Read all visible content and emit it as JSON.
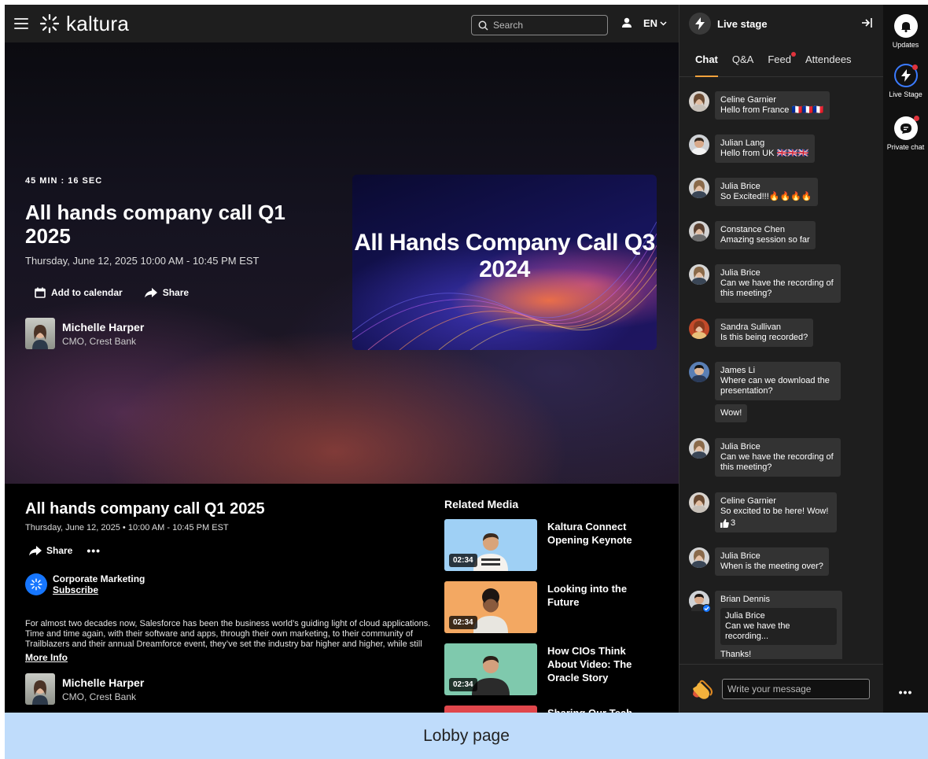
{
  "header": {
    "logo_text": "kaltura",
    "search_placeholder": "Search",
    "language": "EN"
  },
  "hero": {
    "countdown": "45 MIN : 16 SEC",
    "title": "All hands company call Q1 2025",
    "date": "Thursday, June 12, 2025  10:00 AM - 10:45 PM EST",
    "add_to_calendar": "Add to calendar",
    "share": "Share",
    "host_name": "Michelle Harper",
    "host_role": "CMO, Crest Bank",
    "banner_title": "All Hands Company Call Q3 2024"
  },
  "details": {
    "title": "All hands company call Q1 2025",
    "date": "Thursday, June 12, 2025  •  10:00 AM - 10:45 PM EST",
    "share": "Share",
    "more": "•••",
    "channel_name": "Corporate Marketing",
    "subscribe": "Subscribe",
    "description": "For almost two decades now, Salesforce has been the business world’s guiding light of cloud applications. Time and time again, with their software and apps, through their own marketing, to their community of Trailblazers and their annual Dreamforce event, they’ve set the industry bar higher and higher, while still",
    "more_info": "More Info",
    "host_name": "Michelle Harper",
    "host_role": "CMO, Crest Bank"
  },
  "related": {
    "title": "Related Media",
    "items": [
      {
        "title": "Kaltura Connect Opening Keynote",
        "duration": "02:34",
        "bg": "#9fd0f5"
      },
      {
        "title": "Looking into the Future",
        "duration": "02:34",
        "bg": "#f3a862"
      },
      {
        "title": "How CIOs Think About Video: The Oracle Story",
        "duration": "02:34",
        "bg": "#7fc9ad"
      },
      {
        "title": "Sharing Our Tech",
        "duration": "",
        "bg": "#e0474c"
      }
    ]
  },
  "panel": {
    "title": "Live stage",
    "tabs": [
      "Chat",
      "Q&A",
      "Feed",
      "Attendees"
    ],
    "composer_placeholder": "Write your message",
    "messages": [
      {
        "name": "Celine Garnier",
        "text": "Hello from France 🇫🇷🇫🇷🇫🇷"
      },
      {
        "name": "Julian Lang",
        "text": "Hello from UK 🇬🇧🇬🇧🇬🇧"
      },
      {
        "name": "Julia Brice",
        "text": "So Excited!!!🔥🔥🔥🔥"
      },
      {
        "name": "Constance Chen",
        "text": "Amazing session so far"
      },
      {
        "name": "Julia Brice",
        "text": "Can we have the recording of this meeting?"
      },
      {
        "name": "Sandra Sullivan",
        "text": "Is this being recorded?"
      },
      {
        "name": "James Li",
        "text": "Where can we download the presentation?",
        "extra": "Wow!"
      },
      {
        "name": "Julia Brice",
        "text": "Can we have the recording of this meeting?"
      },
      {
        "name": "Celine Garnier",
        "text": "So excited to be here! Wow!",
        "likes": "3"
      },
      {
        "name": "Julia Brice",
        "text": "When is the meeting over?"
      },
      {
        "name": "Brian Dennis",
        "quote_name": "Julia Brice",
        "quote_text": "Can we have the recording...",
        "text": "Thanks!"
      }
    ]
  },
  "rail": {
    "updates": "Updates",
    "live_stage": "Live Stage",
    "private_chat": "Private chat",
    "more": "•••"
  },
  "caption": "Lobby page",
  "colors": {
    "accent_tab": "#f2a23c",
    "notification_dot": "#e0333c",
    "brand_blue": "#1676ff",
    "caption_bg": "#bfdcfb"
  }
}
